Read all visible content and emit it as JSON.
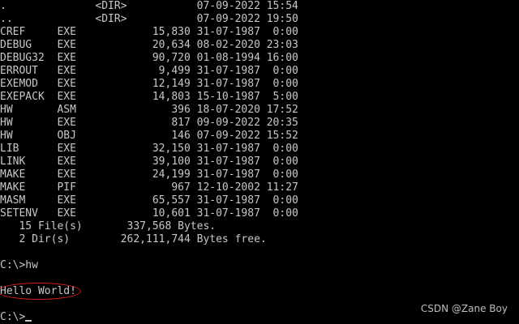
{
  "listing": [
    {
      "name": ".",
      "ext": "",
      "size": "<DIR>",
      "date": "07-09-2022",
      "time": "15:54"
    },
    {
      "name": "..",
      "ext": "",
      "size": "<DIR>",
      "date": "07-09-2022",
      "time": "19:50"
    },
    {
      "name": "CREF",
      "ext": "EXE",
      "size": "15,830",
      "date": "31-07-1987",
      "time": "0:00"
    },
    {
      "name": "DEBUG",
      "ext": "EXE",
      "size": "20,634",
      "date": "08-02-2020",
      "time": "23:03"
    },
    {
      "name": "DEBUG32",
      "ext": "EXE",
      "size": "90,720",
      "date": "01-08-1994",
      "time": "16:00"
    },
    {
      "name": "ERROUT",
      "ext": "EXE",
      "size": "9,499",
      "date": "31-07-1987",
      "time": "0:00"
    },
    {
      "name": "EXEMOD",
      "ext": "EXE",
      "size": "12,149",
      "date": "31-07-1987",
      "time": "0:00"
    },
    {
      "name": "EXEPACK",
      "ext": "EXE",
      "size": "14,803",
      "date": "15-10-1987",
      "time": "5:00"
    },
    {
      "name": "HW",
      "ext": "ASM",
      "size": "396",
      "date": "18-07-2020",
      "time": "17:52"
    },
    {
      "name": "HW",
      "ext": "EXE",
      "size": "817",
      "date": "09-09-2022",
      "time": "20:35"
    },
    {
      "name": "HW",
      "ext": "OBJ",
      "size": "146",
      "date": "07-09-2022",
      "time": "15:52"
    },
    {
      "name": "LIB",
      "ext": "EXE",
      "size": "32,150",
      "date": "31-07-1987",
      "time": "0:00"
    },
    {
      "name": "LINK",
      "ext": "EXE",
      "size": "39,100",
      "date": "31-07-1987",
      "time": "0:00"
    },
    {
      "name": "MAKE",
      "ext": "EXE",
      "size": "24,199",
      "date": "31-07-1987",
      "time": "0:00"
    },
    {
      "name": "MAKE",
      "ext": "PIF",
      "size": "967",
      "date": "12-10-2002",
      "time": "11:27"
    },
    {
      "name": "MASM",
      "ext": "EXE",
      "size": "65,557",
      "date": "31-07-1987",
      "time": "0:00"
    },
    {
      "name": "SETENV",
      "ext": "EXE",
      "size": "10,601",
      "date": "31-07-1987",
      "time": "0:00"
    }
  ],
  "summary": {
    "files_count": "15 File(s)",
    "files_bytes": "337,568 Bytes.",
    "dirs_count": "2 Dir(s)",
    "dirs_bytes": "262,111,744 Bytes free."
  },
  "command_line": "C:\\>hw",
  "program_output": "Hello World!",
  "prompt": "C:\\>",
  "watermark": "CSDN @Zane Boy",
  "colors": {
    "background": "#000000",
    "text": "#C8C8C8",
    "highlight_oval": "#E02020"
  }
}
